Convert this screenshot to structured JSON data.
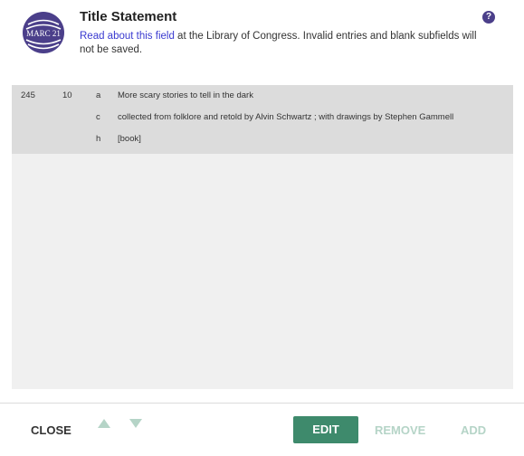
{
  "header": {
    "logo_text": "MARC 21",
    "title": "Title Statement",
    "link_text": "Read about this field",
    "desc_rest": " at the Library of Congress. Invalid entries and blank subfields will not be saved.",
    "help_icon": "?"
  },
  "record": {
    "tag": "245",
    "indicators": "10",
    "subfields": [
      {
        "code": "a",
        "value": "More scary stories to tell in the dark"
      },
      {
        "code": "c",
        "value": "collected from folklore and retold by Alvin Schwartz ; with drawings by Stephen Gammell"
      },
      {
        "code": "h",
        "value": "[book]"
      }
    ]
  },
  "footer": {
    "close_label": "CLOSE",
    "edit_label": "EDIT",
    "remove_label": "REMOVE",
    "add_label": "ADD"
  },
  "icons": {
    "logo": "marc21-logo-icon",
    "help": "help-icon",
    "move_up": "arrow-up-icon",
    "move_down": "arrow-down-icon"
  },
  "colors": {
    "brand_purple": "#4b3f8a",
    "accent_green": "#3e8a6c",
    "disabled_green": "#b5d4c7",
    "link_blue": "#3a3ad0",
    "record_bg": "#dcdcdc",
    "panel_bg": "#f0f0f0"
  }
}
